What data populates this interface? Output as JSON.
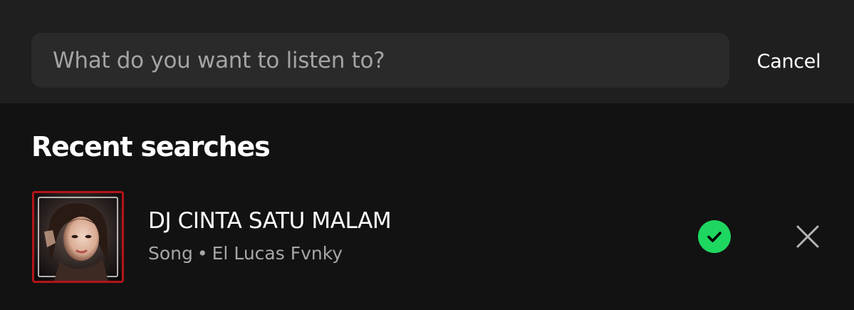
{
  "search": {
    "placeholder": "What do you want to listen to?",
    "value": "",
    "cancel_label": "Cancel"
  },
  "recent": {
    "title": "Recent searches",
    "items": [
      {
        "title": "DJ CINTA SATU MALAM",
        "type": "Song",
        "separator": "•",
        "artist": "El Lucas Fvnky",
        "saved": true,
        "saved_icon": "check-circle-icon",
        "remove_icon": "close-icon"
      }
    ]
  },
  "colors": {
    "background": "#121212",
    "header": "#1f1f1f",
    "search_field": "#2a2a2a",
    "accent_green": "#1ed760",
    "subtext": "#a7a7a7",
    "artwork_border": "#b3151b"
  }
}
